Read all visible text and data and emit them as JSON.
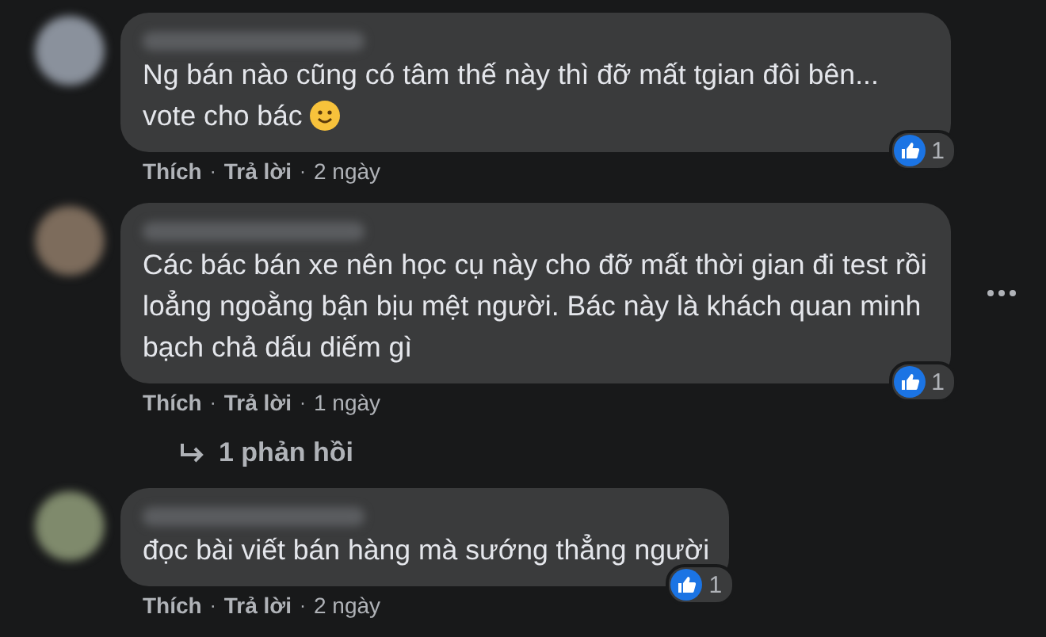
{
  "comments": [
    {
      "text": "Ng bán nào cũng có tâm thế này thì đỡ mất tgian đôi bên... vote cho bác",
      "has_emoji": true,
      "show_more_icon": false,
      "like_label": "Thích",
      "separator": "·",
      "reply_label": "Trả lời",
      "time": "2 ngày",
      "reaction_count": "1"
    },
    {
      "text": "Các bác bán xe nên học cụ này cho đỡ mất thời gian đi test rồi loẳng ngoằng bận bịu mệt người. Bác này là khách quan minh bạch chả dấu diếm gì",
      "has_emoji": false,
      "show_more_icon": true,
      "like_label": "Thích",
      "separator": "·",
      "reply_label": "Trả lời",
      "time": "1 ngày",
      "reaction_count": "1",
      "replies": "1 phản hồi"
    },
    {
      "text": "đọc bài viết bán hàng mà sướng thẳng người",
      "has_emoji": false,
      "show_more_icon": false,
      "like_label": "Thích",
      "separator": "·",
      "reply_label": "Trả lời",
      "time": "2 ngày",
      "reaction_count": "1"
    }
  ]
}
